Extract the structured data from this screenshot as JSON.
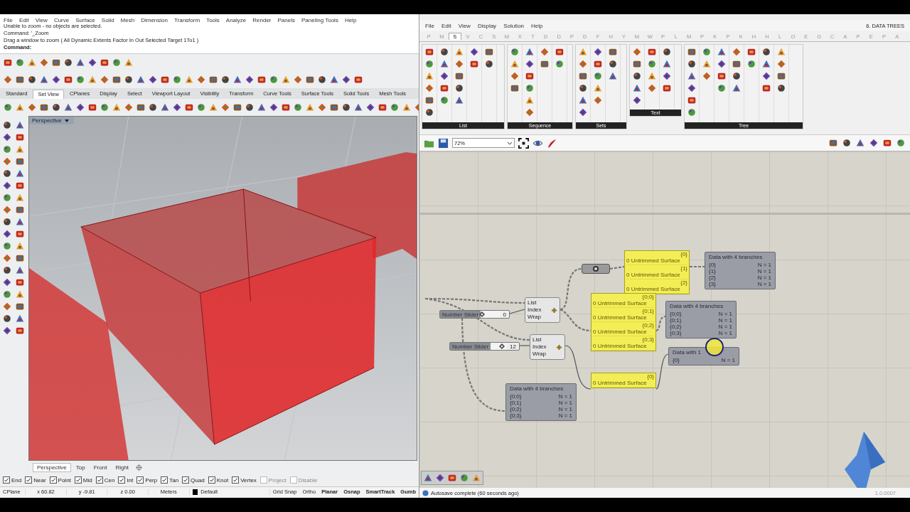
{
  "rhino": {
    "menu": [
      "File",
      "Edit",
      "View",
      "Curve",
      "Surface",
      "Solid",
      "Mesh",
      "Dimension",
      "Transform",
      "Tools",
      "Analyze",
      "Render",
      "Panels",
      "Paneling Tools",
      "Help"
    ],
    "command_history": [
      "Unable to zoom - no objects are selected.",
      "Command: '_Zoom",
      "Drag a window to zoom ( All  Dynamic  Extents  Factor  In  Out  Selected  Target  1To1 )"
    ],
    "command_prompt": "Command:",
    "toolbar_tabs": [
      {
        "label": "Standard",
        "selected": false
      },
      {
        "label": "Set View",
        "selected": true
      },
      {
        "label": "CPlanes",
        "selected": false
      },
      {
        "label": "Display",
        "selected": false
      },
      {
        "label": "Select",
        "selected": false
      },
      {
        "label": "Viewport Layout",
        "selected": false
      },
      {
        "label": "Visibility",
        "selected": false
      },
      {
        "label": "Transform",
        "selected": false
      },
      {
        "label": "Curve Tools",
        "selected": false
      },
      {
        "label": "Surface Tools",
        "selected": false
      },
      {
        "label": "Solid Tools",
        "selected": false
      },
      {
        "label": "Mesh Tools",
        "selected": false
      }
    ],
    "viewport": {
      "title": "Perspective"
    },
    "viewport_tabs": [
      {
        "label": "Perspective",
        "selected": true
      },
      {
        "label": "Top",
        "selected": false
      },
      {
        "label": "Front",
        "selected": false
      },
      {
        "label": "Right",
        "selected": false
      }
    ],
    "osnaps": [
      {
        "label": "End",
        "checked": true
      },
      {
        "label": "Near",
        "checked": true
      },
      {
        "label": "Point",
        "checked": true
      },
      {
        "label": "Mid",
        "checked": true
      },
      {
        "label": "Cen",
        "checked": true
      },
      {
        "label": "Int",
        "checked": true
      },
      {
        "label": "Perp",
        "checked": true
      },
      {
        "label": "Tan",
        "checked": true
      },
      {
        "label": "Quad",
        "checked": true
      },
      {
        "label": "Knot",
        "checked": true
      },
      {
        "label": "Vertex",
        "checked": true
      },
      {
        "label": "Project",
        "checked": false
      },
      {
        "label": "Disable",
        "checked": false
      }
    ],
    "status": {
      "cplane": "CPlane",
      "x": "x 60.82",
      "y": "y -9.81",
      "z": "z 0.00",
      "units": "Meters",
      "layer": "Default",
      "toggles": [
        {
          "label": "Grid Snap",
          "on": false
        },
        {
          "label": "Ortho",
          "on": false
        },
        {
          "label": "Planar",
          "on": true
        },
        {
          "label": "Osnap",
          "on": true
        },
        {
          "label": "SmartTrack",
          "on": true
        },
        {
          "label": "Gumb",
          "on": true
        }
      ]
    }
  },
  "grasshopper": {
    "menu": [
      "File",
      "Edit",
      "View",
      "Display",
      "Solution",
      "Help"
    ],
    "document_title": "6. DATA TREES",
    "category_tabs": [
      {
        "label": "P",
        "selected": false
      },
      {
        "label": "M",
        "selected": false
      },
      {
        "label": "S",
        "selected": true
      },
      {
        "label": "V",
        "selected": false
      },
      {
        "label": "C",
        "selected": false
      },
      {
        "label": "S",
        "selected": false
      },
      {
        "label": "M",
        "selected": false
      },
      {
        "label": "X",
        "selected": false
      },
      {
        "label": "T",
        "selected": false
      },
      {
        "label": "D",
        "selected": false
      },
      {
        "label": "D",
        "selected": false
      },
      {
        "label": "P",
        "selected": false
      },
      {
        "label": "D",
        "selected": false
      },
      {
        "label": "F",
        "selected": false
      },
      {
        "label": "H",
        "selected": false
      },
      {
        "label": "Y",
        "selected": false
      },
      {
        "label": "M",
        "selected": false
      },
      {
        "label": "W",
        "selected": false
      },
      {
        "label": "P",
        "selected": false
      },
      {
        "label": "L",
        "selected": false
      },
      {
        "label": "M",
        "selected": false
      },
      {
        "label": "P",
        "selected": false
      },
      {
        "label": "K",
        "selected": false
      },
      {
        "label": "P",
        "selected": false
      },
      {
        "label": "K",
        "selected": false
      },
      {
        "label": "H",
        "selected": false
      },
      {
        "label": "H",
        "selected": false
      },
      {
        "label": "L",
        "selected": false
      },
      {
        "label": "O",
        "selected": false
      },
      {
        "label": "E",
        "selected": false
      },
      {
        "label": "G",
        "selected": false
      },
      {
        "label": "C",
        "selected": false
      },
      {
        "label": "A",
        "selected": false
      },
      {
        "label": "P",
        "selected": false
      },
      {
        "label": "E",
        "selected": false
      },
      {
        "label": "P",
        "selected": false
      },
      {
        "label": "A",
        "selected": false
      }
    ],
    "panels": [
      "List",
      "Sequence",
      "Sets",
      "Text",
      "Tree"
    ],
    "zoom": "72%",
    "nodes": [
      {
        "kind": "panel",
        "rows": [
          {
            "path": "{0}",
            "text": "0 Untrimmed Surface"
          },
          {
            "path": "{1}",
            "text": "0 Untrimmed Surface"
          },
          {
            "path": "{2}",
            "text": "0 Untrimmed Surface"
          }
        ]
      },
      {
        "kind": "viewer",
        "title": "Data with 4 branches",
        "rows": [
          {
            "path": "{0}",
            "count": "N = 1"
          },
          {
            "path": "{1}",
            "count": "N = 1"
          },
          {
            "path": "{2}",
            "count": "N = 1"
          },
          {
            "path": "{3}",
            "count": "N = 1"
          }
        ]
      },
      {
        "kind": "param"
      },
      {
        "kind": "panel",
        "rows": [
          {
            "path": "{0;0}",
            "text": "0 Untrimmed Surface"
          },
          {
            "path": "{0;1}",
            "text": "0 Untrimmed Surface"
          },
          {
            "path": "{0;2}",
            "text": "0 Untrimmed Surface"
          },
          {
            "path": "{0;3}",
            "text": "0 Untrimmed Surface"
          }
        ]
      },
      {
        "kind": "list_item",
        "inputs": [
          "List",
          "Index",
          "Wrap"
        ]
      },
      {
        "kind": "viewer",
        "title": "Data with 4 branches",
        "rows": [
          {
            "path": "{0;0}",
            "count": "N = 1"
          },
          {
            "path": "{0;1}",
            "count": "N = 1"
          },
          {
            "path": "{0;2}",
            "count": "N = 1"
          },
          {
            "path": "{0;3}",
            "count": "N = 1"
          }
        ]
      },
      {
        "kind": "slider",
        "label": "Number Slider",
        "value": "0",
        "level": 0.05
      },
      {
        "kind": "slider",
        "label": "Number Slider",
        "value": "12",
        "level": 0.7
      },
      {
        "kind": "list_item",
        "inputs": [
          "List",
          "Index",
          "Wrap"
        ]
      },
      {
        "kind": "viewer",
        "title": "Data with 1",
        "rows": [
          {
            "path": "{0}",
            "count": "N = 1"
          }
        ]
      },
      {
        "kind": "panel",
        "rows": [
          {
            "path": "{0}",
            "text": "0 Untrimmed Surface"
          }
        ]
      },
      {
        "kind": "viewer",
        "title": "Data with 4 branches",
        "rows": [
          {
            "path": "{0;0}",
            "count": "N = 1"
          },
          {
            "path": "{0;1}",
            "count": "N = 1"
          },
          {
            "path": "{0;2}",
            "count": "N = 1"
          },
          {
            "path": "{0;3}",
            "count": "N = 1"
          }
        ]
      }
    ],
    "status": "Autosave complete (60 seconds ago)",
    "version": "1.0.0007"
  }
}
